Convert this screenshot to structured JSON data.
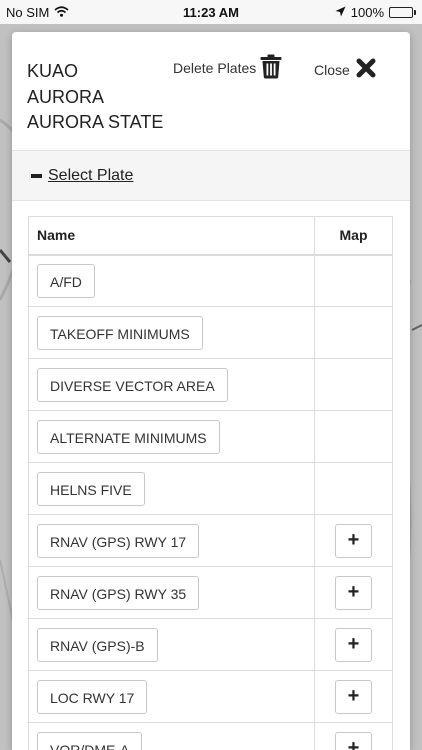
{
  "status_bar": {
    "carrier": "No SIM",
    "time": "11:23 AM",
    "battery_percent": "100%",
    "battery_level": 1.0
  },
  "airport": {
    "code": "KUAO",
    "city": "AURORA",
    "name": "AURORA STATE"
  },
  "header": {
    "delete_label": "Delete Plates",
    "close_label": "Close"
  },
  "select_plate": {
    "label": " Select Plate"
  },
  "table": {
    "columns": [
      "Name",
      "Map"
    ],
    "rows": [
      {
        "name": "A/FD",
        "has_map": false
      },
      {
        "name": "TAKEOFF MINIMUMS",
        "has_map": false
      },
      {
        "name": "DIVERSE VECTOR AREA",
        "has_map": false
      },
      {
        "name": "ALTERNATE MINIMUMS",
        "has_map": false
      },
      {
        "name": "HELNS FIVE",
        "has_map": false
      },
      {
        "name": "RNAV (GPS) RWY 17",
        "has_map": true
      },
      {
        "name": "RNAV (GPS) RWY 35",
        "has_map": true
      },
      {
        "name": "RNAV (GPS)-B",
        "has_map": true
      },
      {
        "name": "LOC RWY 17",
        "has_map": true
      },
      {
        "name": "VOR/DME-A",
        "has_map": true
      }
    ],
    "map_button_label": "+"
  },
  "colors": {
    "battery_fill": "#4cd964",
    "modal_background": "#ffffff",
    "select_bar_background": "#f5f5f5"
  }
}
